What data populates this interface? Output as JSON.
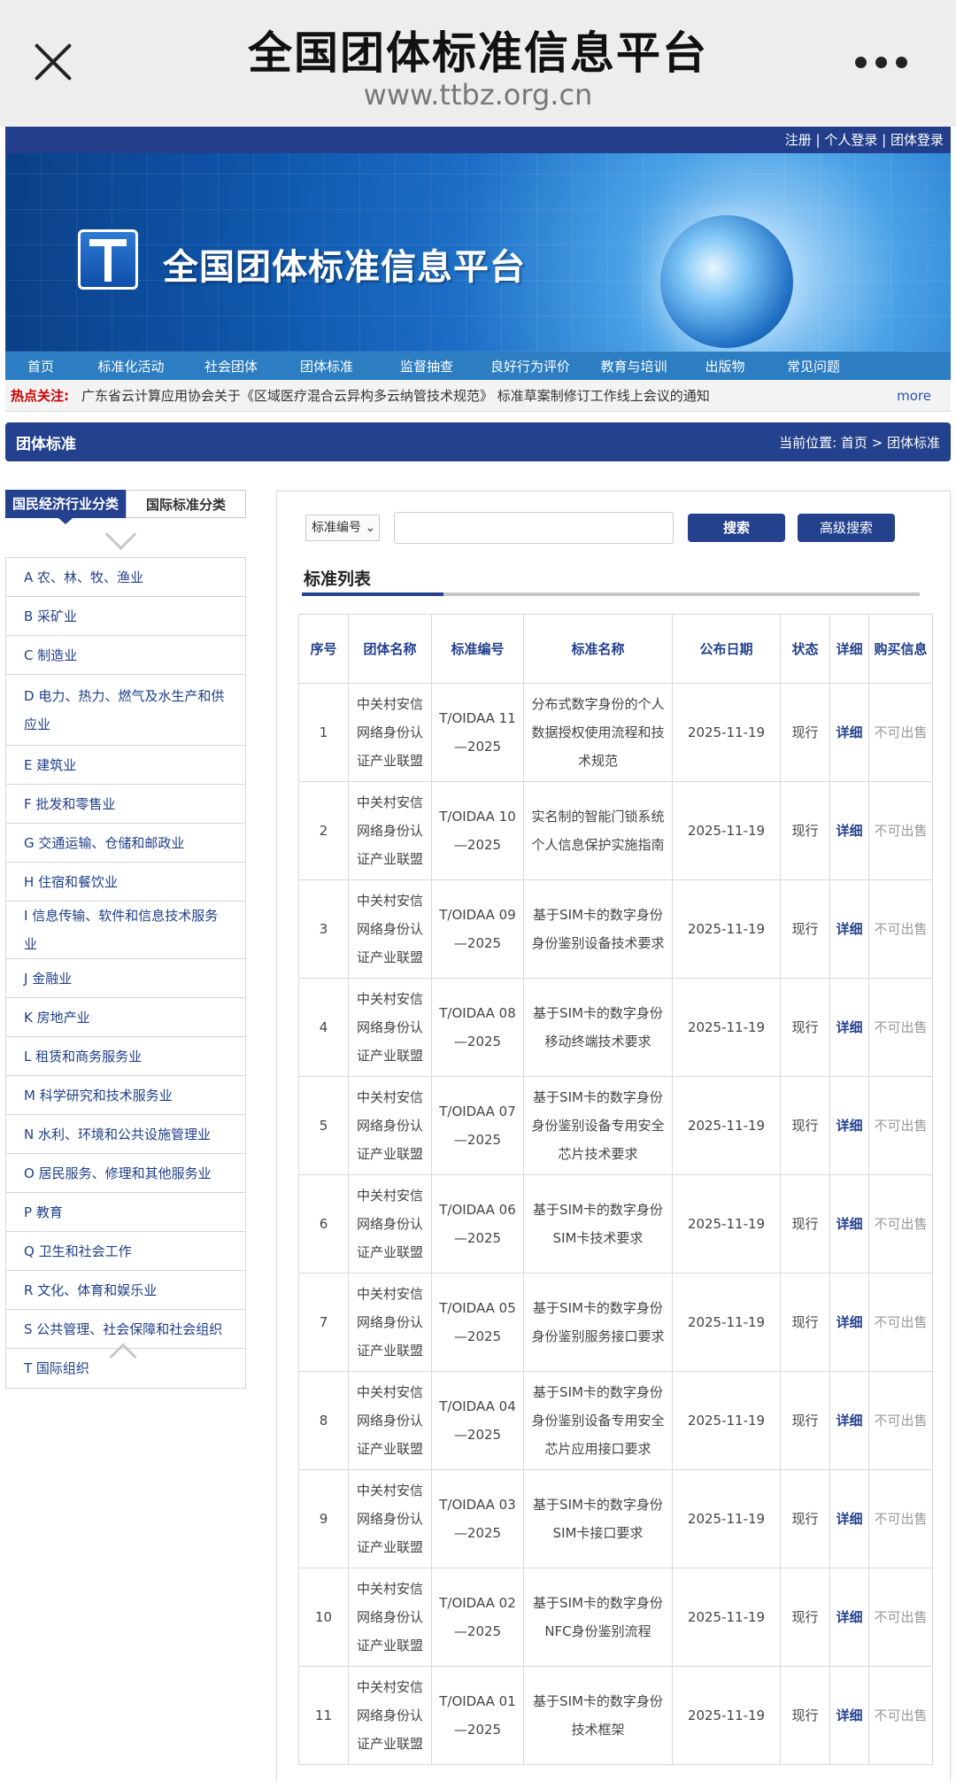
{
  "browser": {
    "title": "全国团体标准信息平台",
    "url": "www.ttbz.org.cn"
  },
  "topbar": {
    "register": "注册",
    "personal_login": "个人登录",
    "group_login": "团体登录",
    "sep": "|"
  },
  "banner": {
    "title": "全国团体标准信息平台"
  },
  "nav": [
    "首页",
    "标准化活动",
    "社会团体",
    "团体标准",
    "监督抽查",
    "良好行为评价",
    "教育与培训",
    "出版物",
    "常见问题"
  ],
  "hot": {
    "label": "热点关注:",
    "text": "广东省云计算应用协会关于《区域医疗混合云异构多云纳管技术规范》 标准草案制修订工作线上会议的通知",
    "more": "more"
  },
  "section": {
    "title": "团体标准",
    "breadcrumb": "当前位置: 首页 > 团体标准"
  },
  "left": {
    "tab_active": "国民经济行业分类",
    "tab_other": "国际标准分类",
    "categories": [
      "A 农、林、牧、渔业",
      "B 采矿业",
      "C 制造业",
      "D 电力、热力、燃气及水生产和供应业",
      "E 建筑业",
      "F 批发和零售业",
      "G 交通运输、仓储和邮政业",
      "H 住宿和餐饮业",
      "I 信息传输、软件和信息技术服务业",
      "J 金融业",
      "K 房地产业",
      "L 租赁和商务服务业",
      "M 科学研究和技术服务业",
      "N 水利、环境和公共设施管理业",
      "O 居民服务、修理和其他服务业",
      "P 教育",
      "Q 卫生和社会工作",
      "R 文化、体育和娱乐业",
      "S 公共管理、社会保障和社会组织",
      "T 国际组织"
    ]
  },
  "search": {
    "select_value": "标准编号",
    "search_label": "搜索",
    "advanced_label": "高级搜索"
  },
  "list": {
    "title": "标准列表",
    "columns": [
      "序号",
      "团体名称",
      "标准编号",
      "标准名称",
      "公布日期",
      "状态",
      "详细",
      "购买信息"
    ],
    "rows": [
      {
        "no": "1",
        "org": "中关村安信网络身份认证产业联盟",
        "code": "T/OIDAA 11—2025",
        "name": "分布式数字身份的个人数据授权使用流程和技术规范",
        "date": "2025-11-19",
        "status": "现行",
        "detail": "详细",
        "buy": "不可出售"
      },
      {
        "no": "2",
        "org": "中关村安信网络身份认证产业联盟",
        "code": "T/OIDAA 10—2025",
        "name": "实名制的智能门锁系统个人信息保护实施指南",
        "date": "2025-11-19",
        "status": "现行",
        "detail": "详细",
        "buy": "不可出售"
      },
      {
        "no": "3",
        "org": "中关村安信网络身份认证产业联盟",
        "code": "T/OIDAA 09—2025",
        "name": "基于SIM卡的数字身份身份鉴别设备技术要求",
        "date": "2025-11-19",
        "status": "现行",
        "detail": "详细",
        "buy": "不可出售"
      },
      {
        "no": "4",
        "org": "中关村安信网络身份认证产业联盟",
        "code": "T/OIDAA 08—2025",
        "name": "基于SIM卡的数字身份移动终端技术要求",
        "date": "2025-11-19",
        "status": "现行",
        "detail": "详细",
        "buy": "不可出售"
      },
      {
        "no": "5",
        "org": "中关村安信网络身份认证产业联盟",
        "code": "T/OIDAA 07—2025",
        "name": "基于SIM卡的数字身份身份鉴别设备专用安全芯片技术要求",
        "date": "2025-11-19",
        "status": "现行",
        "detail": "详细",
        "buy": "不可出售"
      },
      {
        "no": "6",
        "org": "中关村安信网络身份认证产业联盟",
        "code": "T/OIDAA 06—2025",
        "name": "基于SIM卡的数字身份SIM卡技术要求",
        "date": "2025-11-19",
        "status": "现行",
        "detail": "详细",
        "buy": "不可出售"
      },
      {
        "no": "7",
        "org": "中关村安信网络身份认证产业联盟",
        "code": "T/OIDAA 05—2025",
        "name": "基于SIM卡的数字身份身份鉴别服务接口要求",
        "date": "2025-11-19",
        "status": "现行",
        "detail": "详细",
        "buy": "不可出售"
      },
      {
        "no": "8",
        "org": "中关村安信网络身份认证产业联盟",
        "code": "T/OIDAA 04—2025",
        "name": "基于SIM卡的数字身份身份鉴别设备专用安全芯片应用接口要求",
        "date": "2025-11-19",
        "status": "现行",
        "detail": "详细",
        "buy": "不可出售"
      },
      {
        "no": "9",
        "org": "中关村安信网络身份认证产业联盟",
        "code": "T/OIDAA 03—2025",
        "name": "基于SIM卡的数字身份SIM卡接口要求",
        "date": "2025-11-19",
        "status": "现行",
        "detail": "详细",
        "buy": "不可出售"
      },
      {
        "no": "10",
        "org": "中关村安信网络身份认证产业联盟",
        "code": "T/OIDAA 02—2025",
        "name": "基于SIM卡的数字身份NFC身份鉴别流程",
        "date": "2025-11-19",
        "status": "现行",
        "detail": "详细",
        "buy": "不可出售"
      },
      {
        "no": "11",
        "org": "中关村安信网络身份认证产业联盟",
        "code": "T/OIDAA 01—2025",
        "name": "基于SIM卡的数字身份技术框架",
        "date": "2025-11-19",
        "status": "现行",
        "detail": "详细",
        "buy": "不可出售"
      }
    ]
  },
  "colors": {
    "primary": "#23418d",
    "nav": "#2c7dc2",
    "hot_label": "#cc0000"
  }
}
